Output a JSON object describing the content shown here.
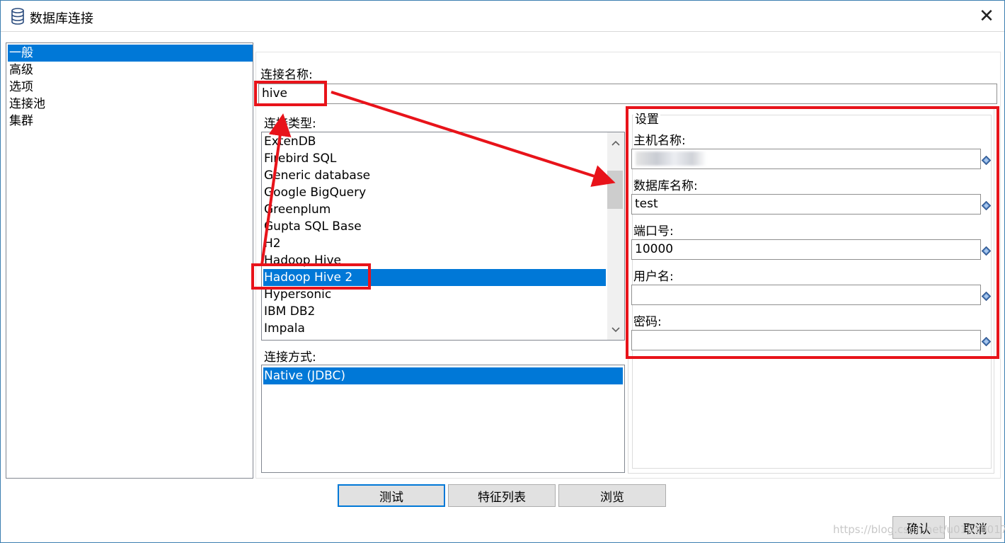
{
  "window": {
    "title": "数据库连接",
    "close_glyph": "✕"
  },
  "nav": {
    "items": [
      "一般",
      "高级",
      "选项",
      "连接池",
      "集群"
    ],
    "selected_index": 0
  },
  "connection_name": {
    "label": "连接名称:",
    "value": "hive"
  },
  "connection_type": {
    "label": "连接类型:",
    "items": [
      "ExtenDB",
      "Firebird SQL",
      "Generic database",
      "Google BigQuery",
      "Greenplum",
      "Gupta SQL Base",
      "H2",
      "Hadoop Hive",
      "Hadoop Hive 2",
      "Hypersonic",
      "IBM DB2",
      "Impala"
    ],
    "selected": "Hadoop Hive 2"
  },
  "access_method": {
    "label": "连接方式:",
    "items": [
      "Native (JDBC)"
    ],
    "selected": "Native (JDBC)"
  },
  "settings": {
    "group_label": "设置",
    "host_label": "主机名称:",
    "host_value": "",
    "database_label": "数据库名称:",
    "database_value": "test",
    "port_label": "端口号:",
    "port_value": "10000",
    "user_label": "用户名:",
    "user_value": "",
    "password_label": "密码:",
    "password_value": ""
  },
  "buttons": {
    "test": "测试",
    "features": "特征列表",
    "explore": "浏览",
    "ok": "确认",
    "cancel": "取消"
  },
  "watermark": "https://blog.csdn.net/u01010017",
  "colors": {
    "selection": "#0078d7",
    "annotation": "#e8131a",
    "window_border": "#3c7fb1"
  },
  "icons": [
    "database-icon",
    "close-icon",
    "chevron-up-icon",
    "chevron-down-icon",
    "variable-diamond-icon"
  ]
}
